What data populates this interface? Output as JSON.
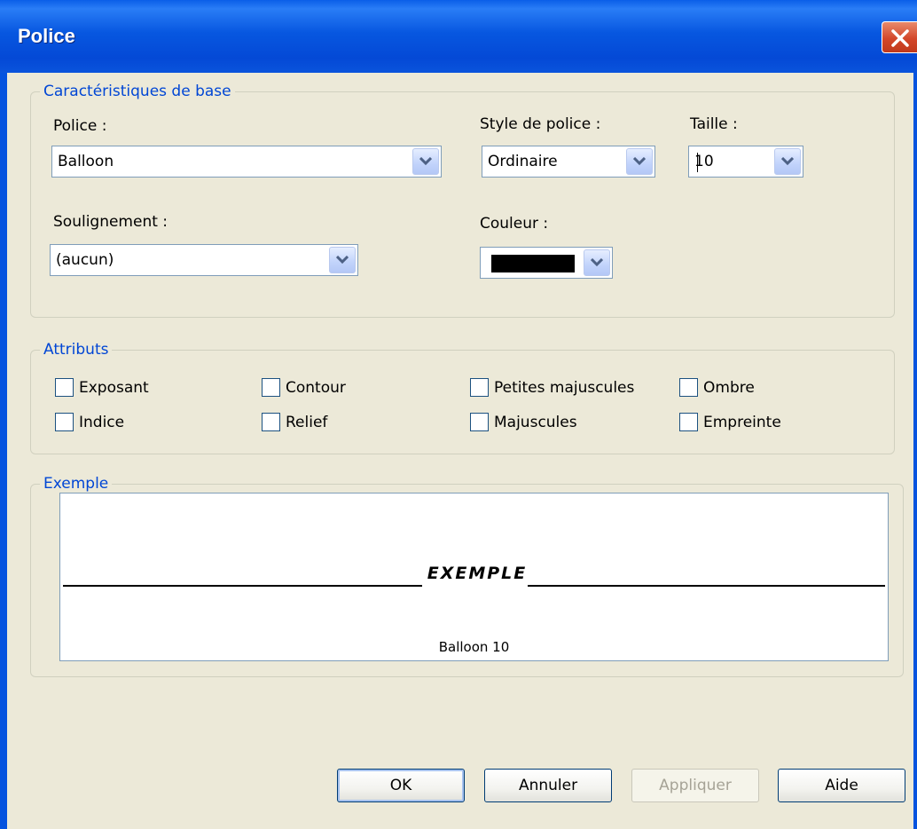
{
  "window": {
    "title": "Police",
    "close_icon": "close-icon"
  },
  "basic": {
    "legend": "Caractéristiques de base",
    "font_label": "Police :",
    "font_value": "Balloon",
    "style_label": "Style de police :",
    "style_value": "Ordinaire",
    "size_label": "Taille :",
    "size_value": "10",
    "underline_label": "Soulignement :",
    "underline_value": "(aucun)",
    "color_label": "Couleur :",
    "color_value": "#000000"
  },
  "attributes": {
    "legend": "Attributs",
    "items": [
      {
        "label": "Exposant",
        "checked": false
      },
      {
        "label": "Contour",
        "checked": false
      },
      {
        "label": "Petites majuscules",
        "checked": false
      },
      {
        "label": "Ombre",
        "checked": false
      },
      {
        "label": "Indice",
        "checked": false
      },
      {
        "label": "Relief",
        "checked": false
      },
      {
        "label": "Majuscules",
        "checked": false
      },
      {
        "label": "Empreinte",
        "checked": false
      }
    ]
  },
  "example": {
    "legend": "Exemple",
    "sample_text": "EXEMPLE",
    "caption": "Balloon 10"
  },
  "buttons": {
    "ok": "OK",
    "cancel": "Annuler",
    "apply": "Appliquer",
    "help": "Aide"
  },
  "colors": {
    "title_bar": "#0553df",
    "legend_text": "#0046d5",
    "dialog_bg": "#ece9d8",
    "disabled_text": "#a6a396"
  }
}
